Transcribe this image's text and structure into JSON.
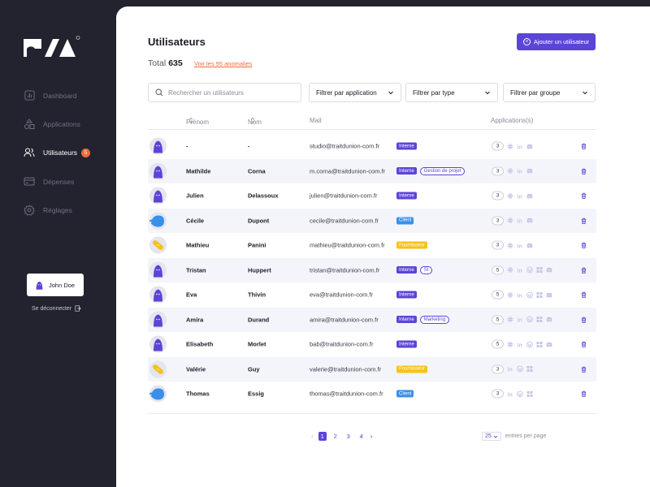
{
  "brand": {
    "logo_icon": "brand-logo"
  },
  "sidebar": {
    "items": [
      {
        "label": "Dashboard",
        "icon": "chart-icon",
        "active": false
      },
      {
        "label": "Applications",
        "icon": "shapes-icon",
        "active": false
      },
      {
        "label": "Utilisateurs",
        "icon": "users-icon",
        "active": true,
        "badge": "5"
      },
      {
        "label": "Dépenses",
        "icon": "card-icon",
        "active": false
      },
      {
        "label": "Réglages",
        "icon": "gear-icon",
        "active": false
      }
    ],
    "user_name": "John Doe",
    "logout_label": "Se déconnecter"
  },
  "header": {
    "title": "Utilisateurs",
    "add_button": "Ajouter un utilisateur",
    "total_label": "Total",
    "total_value": "635",
    "anomalies_link": "Voir les 95 anomalies"
  },
  "search": {
    "placeholder": "Rechercher un utilisateurs"
  },
  "filters": [
    "Filtrer par application",
    "Filtrer par type",
    "Filtrer par groupe"
  ],
  "table": {
    "columns": {
      "first": "Prénom",
      "last": "Nom",
      "mail": "Mail",
      "apps": "Applications(s)"
    },
    "rows": [
      {
        "avatar": "ghost",
        "first": "-",
        "last": "-",
        "mail": "studio@traitdunion-com.fr",
        "tags": [
          {
            "label": "Interne",
            "kind": "interne"
          }
        ],
        "count": "3",
        "apps": [
          "slack",
          "linkedin",
          "discord"
        ]
      },
      {
        "avatar": "ghost",
        "first": "Mathilde",
        "last": "Corna",
        "mail": "m.corna@traitdunion-com.fr",
        "tags": [
          {
            "label": "Interne",
            "kind": "interne"
          },
          {
            "label": "Gestion de projet",
            "kind": "outline"
          }
        ],
        "count": "3",
        "apps": [
          "slack",
          "linkedin",
          "discord"
        ]
      },
      {
        "avatar": "ghost",
        "first": "Julien",
        "last": "Delassoux",
        "mail": "julien@traitdunion-com.fr",
        "tags": [
          {
            "label": "Interne",
            "kind": "interne"
          }
        ],
        "count": "3",
        "apps": [
          "slack",
          "linkedin",
          "discord"
        ]
      },
      {
        "avatar": "bird",
        "first": "Cécile",
        "last": "Dupont",
        "mail": "cecile@traitdunion-com.fr",
        "tags": [
          {
            "label": "Client",
            "kind": "client"
          }
        ],
        "count": "3",
        "apps": [
          "slack",
          "linkedin",
          "discord"
        ]
      },
      {
        "avatar": "bandage",
        "first": "Mathieu",
        "last": "Panini",
        "mail": "mathieu@traitdunion-com.fr",
        "tags": [
          {
            "label": "Fournisseur",
            "kind": "fournisseur"
          }
        ],
        "count": "3",
        "apps": [
          "slack",
          "linkedin",
          "discord"
        ]
      },
      {
        "avatar": "ghost",
        "first": "Tristan",
        "last": "Huppert",
        "mail": "tristan@traitdunion-com.fr",
        "tags": [
          {
            "label": "Interne",
            "kind": "interne"
          },
          {
            "label": "SI",
            "kind": "outline"
          }
        ],
        "count": "5",
        "apps": [
          "slack",
          "linkedin",
          "wordpress",
          "windows",
          "discord"
        ]
      },
      {
        "avatar": "ghost",
        "first": "Eva",
        "last": "Thivin",
        "mail": "eva@traitdunion-com.fr",
        "tags": [
          {
            "label": "Interne",
            "kind": "interne"
          }
        ],
        "count": "5",
        "apps": [
          "slack",
          "linkedin",
          "wordpress",
          "windows",
          "discord"
        ]
      },
      {
        "avatar": "ghost",
        "first": "Amira",
        "last": "Durand",
        "mail": "amira@traitdunion-com.fr",
        "tags": [
          {
            "label": "Interne",
            "kind": "interne"
          },
          {
            "label": "Marketing",
            "kind": "outline"
          }
        ],
        "count": "5",
        "apps": [
          "slack",
          "linkedin",
          "wordpress",
          "windows",
          "discord"
        ]
      },
      {
        "avatar": "ghost",
        "first": "Elisabeth",
        "last": "Morlet",
        "mail": "bab@traitdunion-com.fr",
        "tags": [
          {
            "label": "Interne",
            "kind": "interne"
          }
        ],
        "count": "5",
        "apps": [
          "slack",
          "linkedin",
          "wordpress",
          "windows",
          "discord"
        ]
      },
      {
        "avatar": "bandage",
        "first": "Valérie",
        "last": "Guy",
        "mail": "valerie@traitdunion-com.fr",
        "tags": [
          {
            "label": "Fournisseur",
            "kind": "fournisseur"
          }
        ],
        "count": "3",
        "apps": [
          "linkedin",
          "wordpress",
          "windows"
        ]
      },
      {
        "avatar": "bird",
        "first": "Thomas",
        "last": "Essig",
        "mail": "thomas@traitdunion-com.fr",
        "tags": [
          {
            "label": "Client",
            "kind": "client"
          }
        ],
        "count": "3",
        "apps": [
          "linkedin",
          "wordpress",
          "windows"
        ]
      }
    ]
  },
  "pagination": {
    "pages": [
      "1",
      "2",
      "3",
      "4"
    ],
    "current": "1",
    "per_page": "25",
    "per_page_label": "entries per page"
  },
  "colors": {
    "accent": "#5b45d6",
    "orange": "#ef6b3a",
    "client": "#3a8fe8",
    "supplier": "#f6c21b",
    "sidebar": "#23232f"
  }
}
